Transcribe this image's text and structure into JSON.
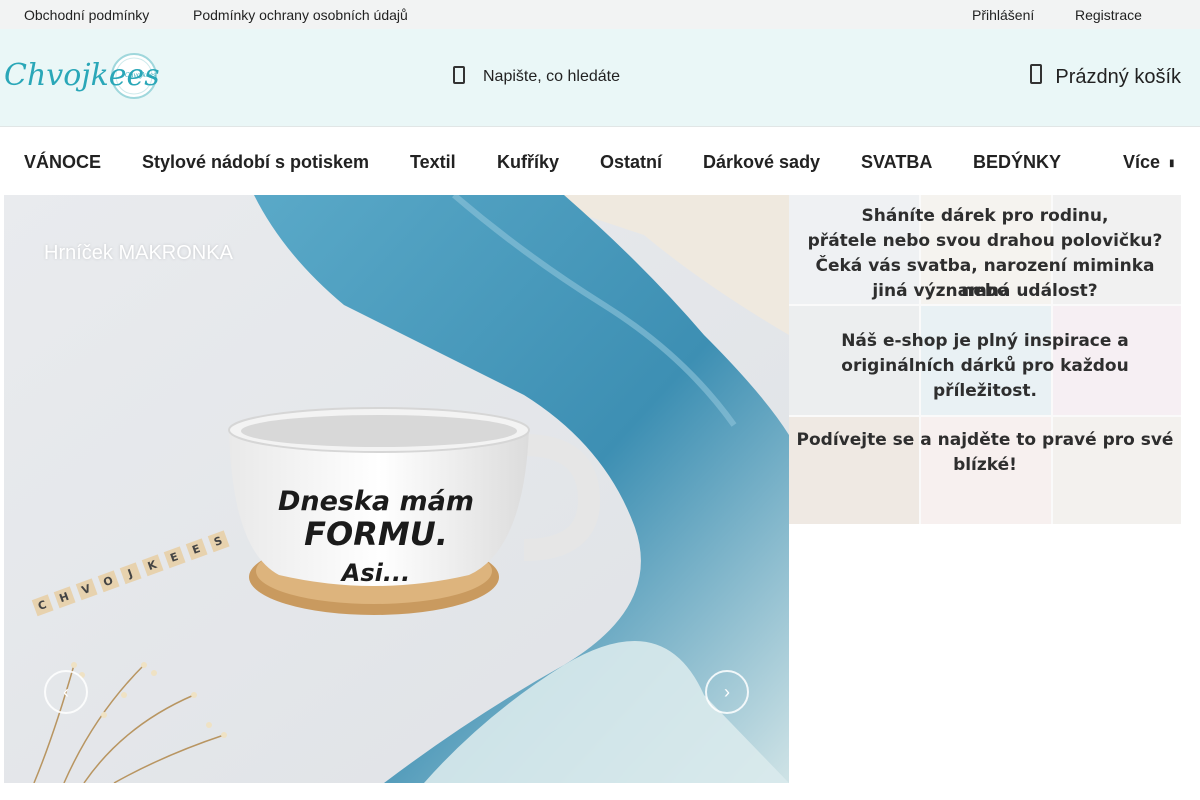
{
  "topbar": {
    "terms": "Obchodní podmínky",
    "privacy": "Podmínky ochrany osobních údajů",
    "login": "Přihlášení",
    "register": "Registrace"
  },
  "header": {
    "logo_text": "Chvojkees",
    "search_placeholder": "Napište, co hledáte",
    "cart_label": "Prázdný košík"
  },
  "nav": {
    "items": [
      "VÁNOCE",
      "Stylové nádobí s potiskem",
      "Textil",
      "Kufříky",
      "Ostatní",
      "Dárkové sady",
      "SVATBA",
      "BEDÝNKY"
    ],
    "more": "Více"
  },
  "hero": {
    "title": "Hrníček MAKRONKA",
    "mug_text": [
      "Dneska mám",
      "FORMU.",
      "Asi..."
    ],
    "blocks": [
      "C",
      "H",
      "V",
      "O",
      "J",
      "K",
      "E",
      "E",
      "S"
    ]
  },
  "promo": {
    "line1": "Sháníte dárek pro rodinu,",
    "line2": "přátele nebo svou drahou polovičku?",
    "line3": "Čeká vás svatba, narození miminka nebo",
    "line4": "jiná významná událost?",
    "line5": "Náš e-shop je plný inspirace a",
    "line6": "originálních dárků pro každou",
    "line7": "příležitost.",
    "line8": "Podívejte se a najděte to pravé pro své",
    "line9": "blízké!"
  },
  "colors": {
    "header_bg": "#eaf7f7",
    "logo": "#2aa7b8",
    "blanket": "#3b93b5"
  }
}
